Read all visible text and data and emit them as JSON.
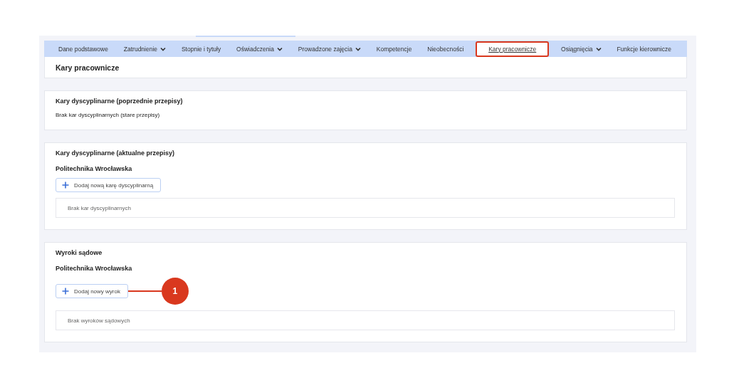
{
  "tabs": [
    {
      "label": "Dane podstawowe",
      "dropdown": false,
      "selected": false,
      "highlighted": false
    },
    {
      "label": "Zatrudnienie",
      "dropdown": true,
      "selected": false,
      "highlighted": false
    },
    {
      "label": "Stopnie i tytuły",
      "dropdown": false,
      "selected": false,
      "highlighted": false
    },
    {
      "label": "Oświadczenia",
      "dropdown": true,
      "selected": false,
      "highlighted": false
    },
    {
      "label": "Prowadzone zajęcia",
      "dropdown": true,
      "selected": false,
      "highlighted": false
    },
    {
      "label": "Kompetencje",
      "dropdown": false,
      "selected": false,
      "highlighted": false
    },
    {
      "label": "Nieobecności",
      "dropdown": false,
      "selected": false,
      "highlighted": false
    },
    {
      "label": "Kary pracownicze",
      "dropdown": false,
      "selected": true,
      "highlighted": true
    },
    {
      "label": "Osiągnięcia",
      "dropdown": true,
      "selected": false,
      "highlighted": false
    },
    {
      "label": "Funkcje kierownicze",
      "dropdown": false,
      "selected": false,
      "highlighted": false
    }
  ],
  "page_title": "Kary pracownicze",
  "sections": [
    {
      "title": "Kary dyscyplinarne (poprzednie przepisy)",
      "text": "Brak kar dyscyplinarnych (stare przepisy)"
    },
    {
      "title": "Kary dyscyplinarne (aktualne przepisy)",
      "organization": "Politechnika Wrocławska",
      "button": "Dodaj nową karę dyscyplinarną",
      "empty": "Brak kar dyscyplinarnych"
    },
    {
      "title": "Wyroki sądowe",
      "organization": "Politechnika Wrocławska",
      "button": "Dodaj nowy wyrok",
      "empty": "Brak wyroków sądowych",
      "callout": "1"
    }
  ]
}
